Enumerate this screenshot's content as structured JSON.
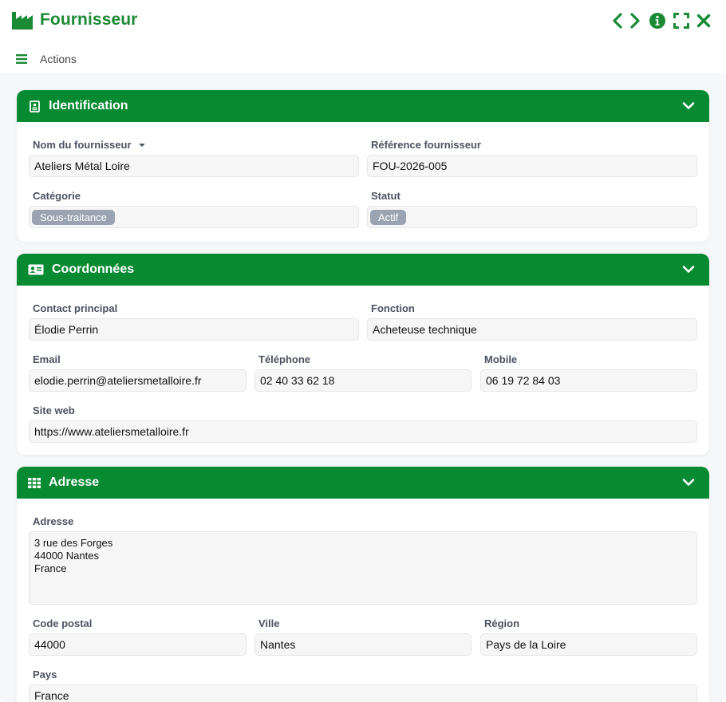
{
  "window": {
    "title": "Fournisseur",
    "app_icon": "factory-icon",
    "toolbar_icons": [
      "chevron-left-icon",
      "chevron-right-icon",
      "info-icon",
      "expand-icon",
      "close-icon"
    ],
    "accent_color": "#078a32"
  },
  "actions": {
    "label": "Actions",
    "icon": "hamburger-icon"
  },
  "identification": {
    "title": "Identification",
    "icon": "id-badge-icon",
    "nom_label": "Nom du fournisseur",
    "nom_value": "Ateliers Métal Loire",
    "ref_label": "Référence fournisseur",
    "ref_value": "FOU-2026-005",
    "categorie_label": "Catégorie",
    "categorie_value": "Sous-traitance",
    "statut_label": "Statut",
    "statut_value": "Actif"
  },
  "coordonnees": {
    "title": "Coordonnées",
    "icon": "contact-card-icon",
    "contact_label": "Contact principal",
    "contact_value": "Élodie Perrin",
    "fonction_label": "Fonction",
    "fonction_value": "Acheteuse technique",
    "email_label": "Email",
    "email_value": "elodie.perrin@ateliersmetalloire.fr",
    "telephone_label": "Téléphone",
    "telephone_value": "02 40 33 62 18",
    "mobile_label": "Mobile",
    "mobile_value": "06 19 72 84 03",
    "site_label": "Site web",
    "site_value": "https://www.ateliersmetalloire.fr"
  },
  "adresse": {
    "title": "Adresse",
    "icon": "grid-icon",
    "adresse_label": "Adresse",
    "adresse_value": "3 rue des Forges\n44000 Nantes\nFrance",
    "cp_label": "Code postal",
    "cp_value": "44000",
    "ville_label": "Ville",
    "ville_value": "Nantes",
    "region_label": "Région",
    "region_value": "Pays de la Loire",
    "pays_label": "Pays",
    "pays_value": "France"
  }
}
